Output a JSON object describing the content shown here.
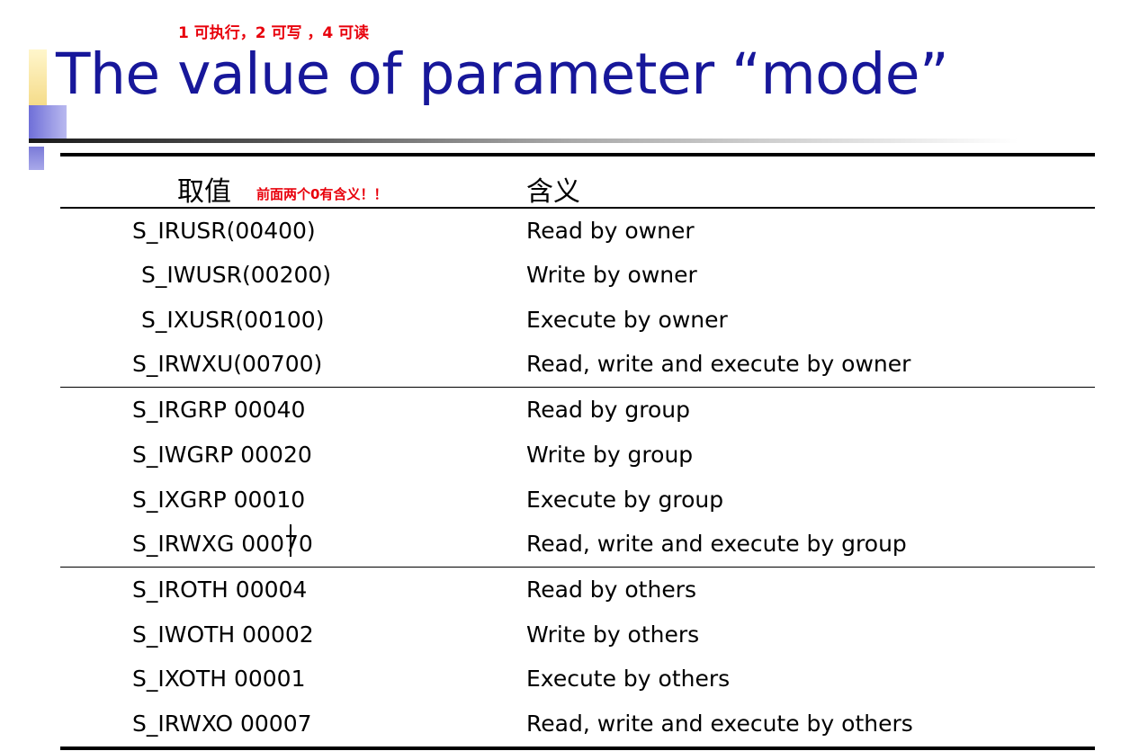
{
  "annotations": {
    "top_note": "1 可执行，2 可写 ，4 可读",
    "header_note": "前面两个0有含义！！"
  },
  "title": "The value of parameter “mode”",
  "table": {
    "headers": {
      "value": "取值",
      "meaning": "含义"
    },
    "groups": [
      {
        "rows": [
          {
            "value": "S_IRUSR(00400)",
            "meaning": "Read by owner"
          },
          {
            "value": "S_IWUSR(00200)",
            "meaning": "Write by owner"
          },
          {
            "value": "S_IXUSR(00100)",
            "meaning": "Execute by owner"
          },
          {
            "value": "S_IRWXU(00700)",
            "meaning": "Read, write and execute by owner"
          }
        ]
      },
      {
        "rows": [
          {
            "value": "S_IRGRP 00040",
            "meaning": "Read by group"
          },
          {
            "value": "S_IWGRP 00020",
            "meaning": "Write by group"
          },
          {
            "value": "S_IXGRP 00010",
            "meaning": "Execute by group"
          },
          {
            "value": "S_IRWXG 00070",
            "meaning": "Read, write and execute by group"
          }
        ]
      },
      {
        "rows": [
          {
            "value": "S_IROTH 00004",
            "meaning": "Read by others"
          },
          {
            "value": "S_IWOTH 00002",
            "meaning": "Write by others"
          },
          {
            "value": "S_IXOTH 00001",
            "meaning": "Execute by others"
          },
          {
            "value": "S_IRWXO 00007",
            "meaning": "Read, write and execute by others"
          }
        ]
      }
    ]
  },
  "colors": {
    "title": "#17179a",
    "annotation": "#e8000b"
  }
}
